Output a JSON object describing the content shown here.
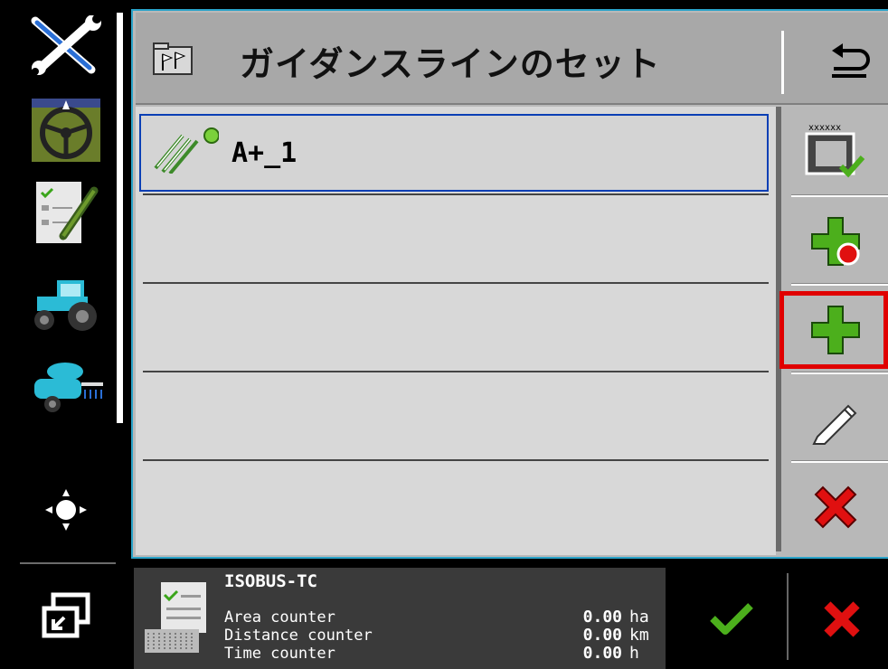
{
  "header": {
    "title": "ガイダンスラインのセット"
  },
  "sidebar": {
    "items": [
      {
        "icon": "tools-icon"
      },
      {
        "icon": "steering-wheel-icon"
      },
      {
        "icon": "checklist-icon"
      },
      {
        "icon": "tractor-icon"
      },
      {
        "icon": "sprayer-icon"
      },
      {
        "icon": "brightness-icon"
      },
      {
        "icon": "switch-window-icon"
      }
    ]
  },
  "list": {
    "items": [
      {
        "label": "A+_1",
        "selected": true
      },
      {
        "label": ""
      },
      {
        "label": ""
      },
      {
        "label": ""
      },
      {
        "label": ""
      }
    ]
  },
  "toolbar": {
    "buttons": [
      {
        "icon": "select-confirm-icon"
      },
      {
        "icon": "add-record-icon"
      },
      {
        "icon": "add-icon"
      },
      {
        "icon": "edit-icon"
      },
      {
        "icon": "delete-icon"
      }
    ],
    "highlight_index": 2
  },
  "counter": {
    "title": "ISOBUS-TC",
    "rows": [
      {
        "label": "Area counter",
        "value": "0.00",
        "unit": "ha"
      },
      {
        "label": "Distance counter",
        "value": "0.00",
        "unit": "km"
      },
      {
        "label": "Time counter",
        "value": "0.00",
        "unit": "h"
      }
    ]
  },
  "colors": {
    "frame_border": "#2aa3c9",
    "selected_border": "#0a3fb5",
    "highlight": "#e00000",
    "green": "#4caf1c",
    "red": "#e01010"
  }
}
